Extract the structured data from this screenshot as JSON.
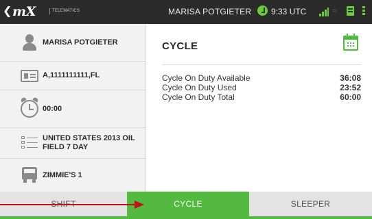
{
  "top_bar": {
    "logo": "mX",
    "logo_sub": "TELEMATICS",
    "driver_name": "MARISA POTGIETER",
    "time": "9:33 UTC",
    "icons": [
      "back-chevron-icon",
      "clock-status-icon",
      "signal-icon",
      "wifi-icon",
      "log-icon",
      "menu-icon"
    ]
  },
  "left_panel": {
    "items": [
      {
        "icon": "person-icon",
        "label": "MARISA POTGIETER"
      },
      {
        "icon": "license-card-icon",
        "label": "A,1111111111,FL"
      },
      {
        "icon": "alarm-clock-icon",
        "label": "00:00"
      },
      {
        "icon": "checklist-icon",
        "label": "UNITED STATES 2013 OIL FIELD 7 DAY"
      },
      {
        "icon": "truck-icon",
        "label": "ZIMMIE'S 1"
      }
    ]
  },
  "main": {
    "title": "CYCLE",
    "rows": [
      {
        "label": "Cycle On Duty Available",
        "value": "36:08"
      },
      {
        "label": "Cycle On Duty Used",
        "value": "23:52"
      },
      {
        "label": "Cycle On Duty Total",
        "value": "60:00"
      }
    ]
  },
  "tabs": [
    {
      "label": "SHIFT",
      "active": false
    },
    {
      "label": "CYCLE",
      "active": true
    },
    {
      "label": "SLEEPER",
      "active": false
    }
  ],
  "colors": {
    "accent_green": "#53b940",
    "top_bar": "#2b2b2b",
    "annotation_arrow": "#c0121b"
  }
}
